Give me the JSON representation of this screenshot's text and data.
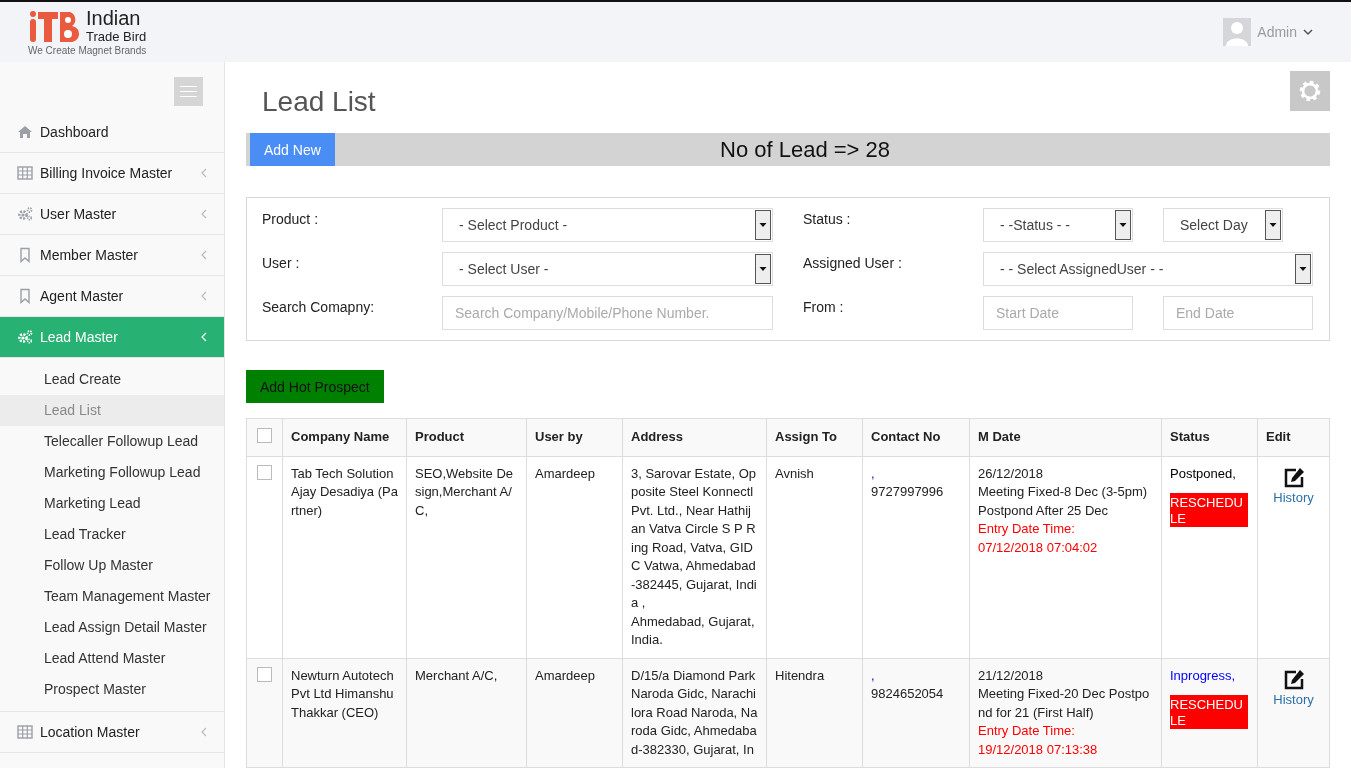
{
  "header": {
    "logo_name": "Indian",
    "logo_sub": "Trade Bird",
    "tagline": "We Create Magnet Brands",
    "user": "Admin"
  },
  "sidebar": {
    "items": [
      {
        "label": "Dashboard",
        "kind": "home",
        "collapsible": false,
        "selected": false
      },
      {
        "label": "Billing Invoice Master",
        "kind": "table",
        "collapsible": true,
        "selected": false
      },
      {
        "label": "User Master",
        "kind": "gears",
        "collapsible": true,
        "selected": false
      },
      {
        "label": "Member Master",
        "kind": "bookmark",
        "collapsible": true,
        "selected": false
      },
      {
        "label": "Agent Master",
        "kind": "bookmark",
        "collapsible": true,
        "selected": false
      },
      {
        "label": "Lead Master",
        "kind": "gears",
        "collapsible": true,
        "selected": true,
        "children": [
          {
            "label": "Lead Create",
            "selected": false
          },
          {
            "label": "Lead List",
            "selected": true
          },
          {
            "label": "Telecaller Followup Lead",
            "selected": false
          },
          {
            "label": "Marketing Followup Lead",
            "selected": false
          },
          {
            "label": "Marketing Lead",
            "selected": false
          },
          {
            "label": "Lead Tracker",
            "selected": false
          },
          {
            "label": "Follow Up Master",
            "selected": false
          },
          {
            "label": "Team Management Master",
            "selected": false
          },
          {
            "label": "Lead Assign Detail Master",
            "selected": false
          },
          {
            "label": "Lead Attend Master",
            "selected": false
          },
          {
            "label": "Prospect Master",
            "selected": false
          }
        ]
      },
      {
        "label": "Location Master",
        "kind": "table",
        "collapsible": true,
        "selected": false
      }
    ]
  },
  "page": {
    "title": "Lead List",
    "add_button": "Add New",
    "lead_count": "No of Lead => 28",
    "hot_prospect_button": "Add Hot Prospect"
  },
  "filters": [
    {
      "label": "Product :",
      "controls": [
        {
          "kind": "select",
          "value": "- Select Product -"
        }
      ]
    },
    {
      "label": "Status :",
      "controls": [
        {
          "kind": "select",
          "value": "- -Status - -"
        },
        {
          "kind": "select",
          "value": "Select Day"
        }
      ]
    },
    {
      "label": "User :",
      "controls": [
        {
          "kind": "select",
          "value": "- Select User -"
        }
      ]
    },
    {
      "label": "Assigned User :",
      "controls": [
        {
          "kind": "select",
          "value": "- - Select AssignedUser - -"
        }
      ]
    },
    {
      "label": "Search Comapny:",
      "controls": [
        {
          "kind": "input",
          "placeholder": "Search Company/Mobile/Phone Number."
        }
      ]
    },
    {
      "label": "From :",
      "controls": [
        {
          "kind": "input",
          "placeholder": "Start Date"
        },
        {
          "kind": "input",
          "placeholder": "End Date"
        }
      ]
    }
  ],
  "table": {
    "all_checked": false,
    "columns": [
      "Company Name",
      "Product",
      "User by",
      "Address",
      "Assign To",
      "Contact No",
      "M Date",
      "Status",
      "Edit"
    ],
    "rows": [
      {
        "checked": false,
        "company": "Tab Tech Solution Ajay Desadiya (Partner)",
        "product": "SEO,Website Design,Merchant A/C,",
        "user_by": "Amardeep",
        "address": [
          "3, Sarovar Estate, Opposite Steel Konnectl Pvt. Ltd., Near Hathijan Vatva Circle S P Ring Road, Vatva, GIDC Vatwa, Ahmedabad-382445, Gujarat, India ,",
          "Ahmedabad, Gujarat, India."
        ],
        "assign_to": "Avnish",
        "contact_prefix": ",",
        "contact": "9727997996",
        "m_date": "26/12/2018",
        "note": "Meeting Fixed-8 Dec (3-5pm) Postpond After 25 Dec",
        "entry_label": "Entry Date Time:",
        "entry_time": "07/12/2018 07:04:02",
        "status": {
          "text": "Postponed,",
          "color": "#000000"
        },
        "badge": "RESCHEDULE",
        "history": "History"
      },
      {
        "checked": false,
        "company": "Newturn Autotech Pvt Ltd Himanshu Thakkar (CEO)",
        "product": "Merchant A/C,",
        "user_by": "Amardeep",
        "address": [
          "D/15/a Diamond Park Naroda Gidc, Narachilora Road Naroda, Naroda Gidc, Ahmedabad-382330, Gujarat, In"
        ],
        "assign_to": "Hitendra",
        "contact_prefix": ",",
        "contact": "9824652054",
        "m_date": "21/12/2018",
        "note": "Meeting Fixed-20 Dec Postpond for 21 (First Half)",
        "entry_label": "Entry Date Time:",
        "entry_time": "19/12/2018 07:13:38",
        "status": {
          "text": "Inprogress,",
          "color": "#0000ff"
        },
        "badge": "RESCHEDULE",
        "history": "History"
      }
    ]
  }
}
